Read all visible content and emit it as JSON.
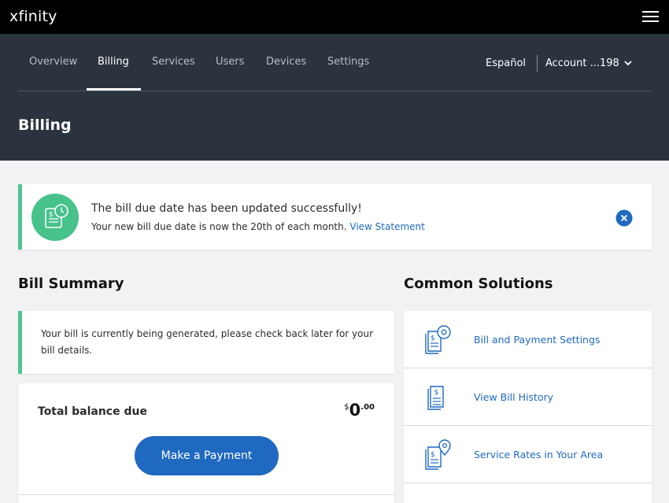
{
  "header": {
    "logo": "xfinity"
  },
  "nav": {
    "tabs": [
      {
        "label": "Overview"
      },
      {
        "label": "Billing"
      },
      {
        "label": "Services"
      },
      {
        "label": "Users"
      },
      {
        "label": "Devices"
      },
      {
        "label": "Settings"
      }
    ],
    "active_tab": "Billing",
    "language_link": "Español",
    "account_label": "Account ...198"
  },
  "page": {
    "title": "Billing"
  },
  "alert": {
    "title": "The bill due date has been updated successfully!",
    "message": "Your new bill due date is now the 20th of each month.",
    "link": "View Statement"
  },
  "bill_summary": {
    "heading": "Bill Summary",
    "info": "Your bill is currently being generated, please check back later for your bill details.",
    "balance_label": "Total balance due",
    "balance": {
      "currency": "$",
      "dollars": "0",
      "cents": ".00"
    },
    "pay_button": "Make a Payment"
  },
  "common_solutions": {
    "heading": "Common Solutions",
    "items": [
      {
        "label": "Bill and Payment Settings",
        "icon": "bill-settings-icon"
      },
      {
        "label": "View Bill History",
        "icon": "bill-history-icon"
      },
      {
        "label": "Service Rates in Your Area",
        "icon": "location-bill-icon"
      }
    ]
  },
  "colors": {
    "brand_blue": "#1f69c1",
    "success_green": "#4ec592",
    "nav_background": "#2b333f",
    "top_bar": "#000000"
  }
}
